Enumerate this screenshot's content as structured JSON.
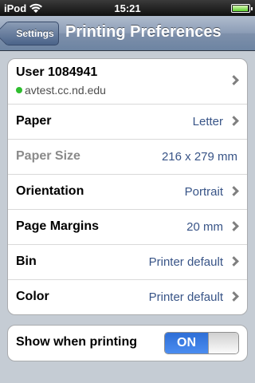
{
  "status_bar": {
    "carrier": "iPod",
    "time": "15:21"
  },
  "nav": {
    "back_label": "Settings",
    "title": "Printing Preferences"
  },
  "printer": {
    "name": "User 1084941",
    "host": "avtest.cc.nd.edu",
    "status_color": "#2fbe2f"
  },
  "settings": [
    {
      "label": "Paper",
      "value": "Letter"
    },
    {
      "label": "Paper Size",
      "value": "216 x 279 mm"
    },
    {
      "label": "Orientation",
      "value": "Portrait"
    },
    {
      "label": "Page Margins",
      "value": "20 mm"
    },
    {
      "label": "Bin",
      "value": "Printer default"
    },
    {
      "label": "Color",
      "value": "Printer default"
    }
  ],
  "show_when_printing": {
    "label": "Show when printing",
    "state_label": "ON"
  },
  "colors": {
    "value_text": "#385487",
    "switch_on": "#2e6ed6"
  }
}
